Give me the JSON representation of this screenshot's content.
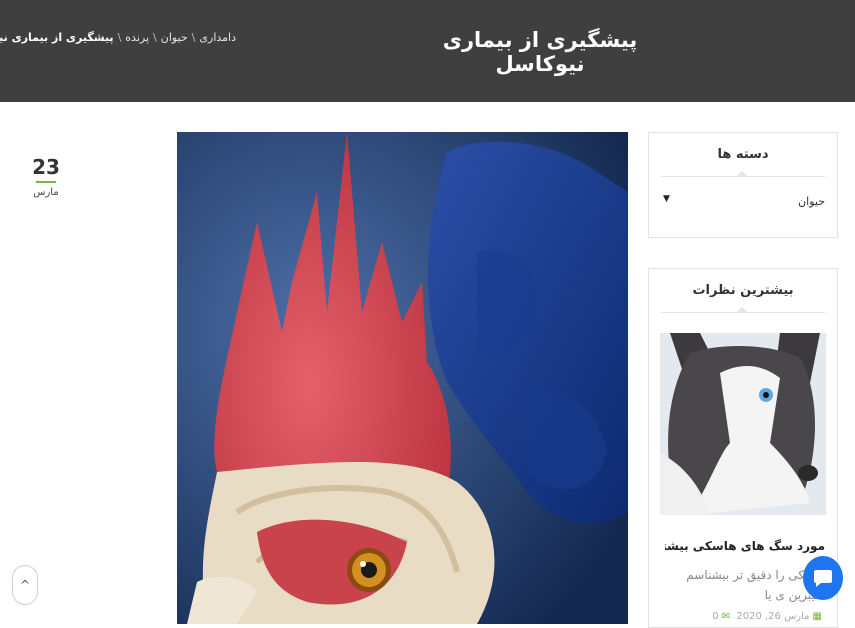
{
  "header": {
    "title": "پیشگیری از بیماری نیوکاسل",
    "breadcrumb": [
      {
        "label": "دامداری"
      },
      {
        "label": "حیوان"
      },
      {
        "label": "پرنده"
      },
      {
        "label": "پیشگیری از بیماری نیوکاسل"
      }
    ],
    "separator": "\\"
  },
  "post": {
    "date_day": "23",
    "date_month": "مارس"
  },
  "sidebar": {
    "categories": {
      "title": "دسته ها",
      "selected": "حیوان",
      "caret": "▼"
    },
    "top_comments": {
      "title": "بیشترین نظرات",
      "post_title": "مورد سگ های هاسکی بیشتر بدانید",
      "post_excerpt": "هاسکی را دقیق تر بیشناسم سیبرین ی یا",
      "post_date": "مارس 26, 2020",
      "post_comments": "0"
    }
  },
  "floating": {
    "scroll_top_icon": "^",
    "chat_icon": "chat-bubble-icon"
  },
  "colors": {
    "header_bg": "#3f3f3f",
    "accent_green": "#7cb342",
    "chat_blue": "#1f74f0"
  }
}
